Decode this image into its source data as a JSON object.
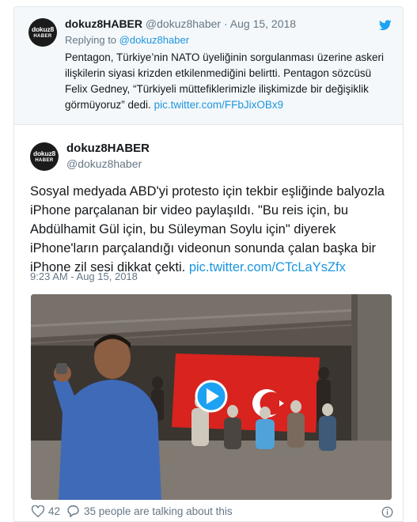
{
  "reply_tweet": {
    "avatar_text_top": "dokuz8",
    "avatar_text_bottom": "HABER",
    "author_name": "dokuz8HABER",
    "author_handle": "@dokuz8haber",
    "separator": "·",
    "date": "Aug 15, 2018",
    "replying_prefix": "Replying to ",
    "replying_to": "@dokuz8haber",
    "text": "Pentagon, Türkiye’nin NATO üyeliğinin sorgulanması üzerine askeri ilişkilerin siyasi krizden etkilenmediğini belirtti. Pentagon sözcüsü Felix Gedney, “Türkiyeli müttefiklerimizle ilişkimizde bir değişiklik görmüyoruz” dedi. ",
    "link": "pic.twitter.com/FFbJixOBx9",
    "icon": "twitter-bird-icon",
    "brand_color": "#1da1f2"
  },
  "main_tweet": {
    "avatar_text_top": "dokuz8",
    "avatar_text_bottom": "HABER",
    "author_name": "dokuz8HABER",
    "author_handle": "@dokuz8haber",
    "text": "Sosyal medyada ABD'yi protesto için tekbir eşliğinde balyozla iPhone parçalanan bir video paylaşıldı. \"Bu reis için, bu Abdülhamit Gül için, bu Süleyman Soylu için\" diyerek iPhone'ların parçalandığı videonun sonunda çalan başka bir iPhone zil sesi dikkat çekti. ",
    "link": "pic.twitter.com/CTcLaYsZfx",
    "timestamp": "9:23 AM - Aug 15, 2018",
    "media": {
      "type": "video",
      "icon": "play-icon",
      "flag_color": "#d8231f"
    },
    "likes": "42",
    "replies_text": "35 people are talking about this",
    "icons": [
      "heart-icon",
      "comment-icon",
      "info-icon"
    ],
    "link_color": "#1b95e0"
  }
}
